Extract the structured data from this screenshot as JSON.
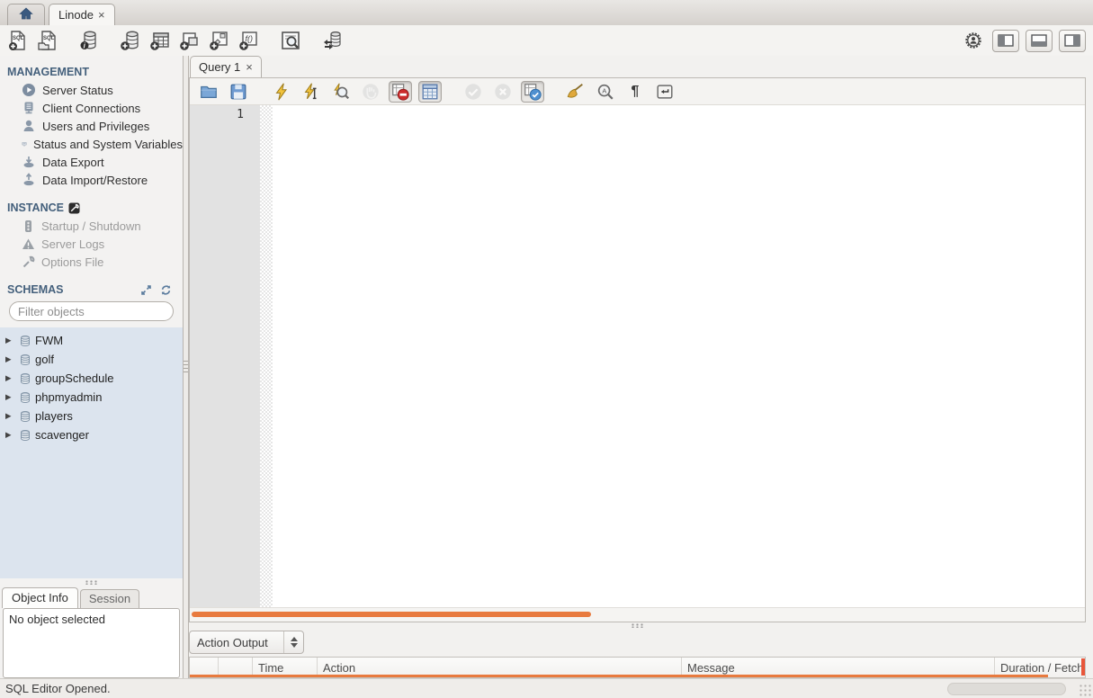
{
  "icons": {
    "caret": "▶",
    "close": "×",
    "pilcrow": "¶",
    "main_toolbar": [
      "new-sql-tab-icon",
      "open-sql-script-icon",
      "schema-inspector-icon",
      "create-schema-icon",
      "create-table-icon",
      "create-view-icon",
      "create-procedure-icon",
      "create-function-icon",
      "search-data-icon",
      "reconnect-icon",
      "preferences-icon",
      "toggle-left-panel-icon",
      "toggle-bottom-panel-icon",
      "toggle-right-panel-icon"
    ],
    "sql_toolbar": [
      "open-script-icon",
      "save-script-icon",
      "execute-icon",
      "execute-current-icon",
      "explain-icon",
      "stop-icon",
      "toggle-stop-on-error-icon",
      "limit-rows-icon",
      "commit-icon",
      "rollback-icon",
      "toggle-autocommit-icon",
      "beautify-icon",
      "find-icon",
      "show-invisibles-icon",
      "wrap-text-icon"
    ]
  },
  "window": {
    "connection_tab": {
      "label": "Linode"
    }
  },
  "sidebar": {
    "management": {
      "title": "MANAGEMENT",
      "items": [
        {
          "icon": "server-status-icon",
          "label": "Server Status"
        },
        {
          "icon": "client-connections-icon",
          "label": "Client Connections"
        },
        {
          "icon": "users-icon",
          "label": "Users and Privileges"
        },
        {
          "icon": "system-variables-icon",
          "label": "Status and System Variables"
        },
        {
          "icon": "data-export-icon",
          "label": "Data Export"
        },
        {
          "icon": "data-import-icon",
          "label": "Data Import/Restore"
        }
      ]
    },
    "instance": {
      "title": "INSTANCE",
      "items": [
        {
          "icon": "startup-shutdown-icon",
          "label": "Startup / Shutdown"
        },
        {
          "icon": "server-logs-icon",
          "label": "Server Logs"
        },
        {
          "icon": "options-file-icon",
          "label": "Options File"
        }
      ]
    },
    "schemas": {
      "title": "SCHEMAS",
      "filter_placeholder": "Filter objects",
      "items": [
        {
          "name": "FWM"
        },
        {
          "name": "golf"
        },
        {
          "name": "groupSchedule"
        },
        {
          "name": "phpmyadmin"
        },
        {
          "name": "players"
        },
        {
          "name": "scavenger"
        }
      ]
    },
    "info_tabs": [
      {
        "label": "Object Info"
      },
      {
        "label": "Session"
      }
    ],
    "object_info_text": "No object selected"
  },
  "editor": {
    "tab_label": "Query 1",
    "line_number": "1"
  },
  "output": {
    "selector_value": "Action Output",
    "columns": [
      "",
      "",
      "Time",
      "Action",
      "Message",
      "Duration / Fetch"
    ]
  },
  "statusbar": {
    "text": "SQL Editor Opened."
  },
  "colors": {
    "accent_orange": "#e87a3e",
    "schema_list_bg": "#dce4ee",
    "section_header": "#44607c"
  }
}
